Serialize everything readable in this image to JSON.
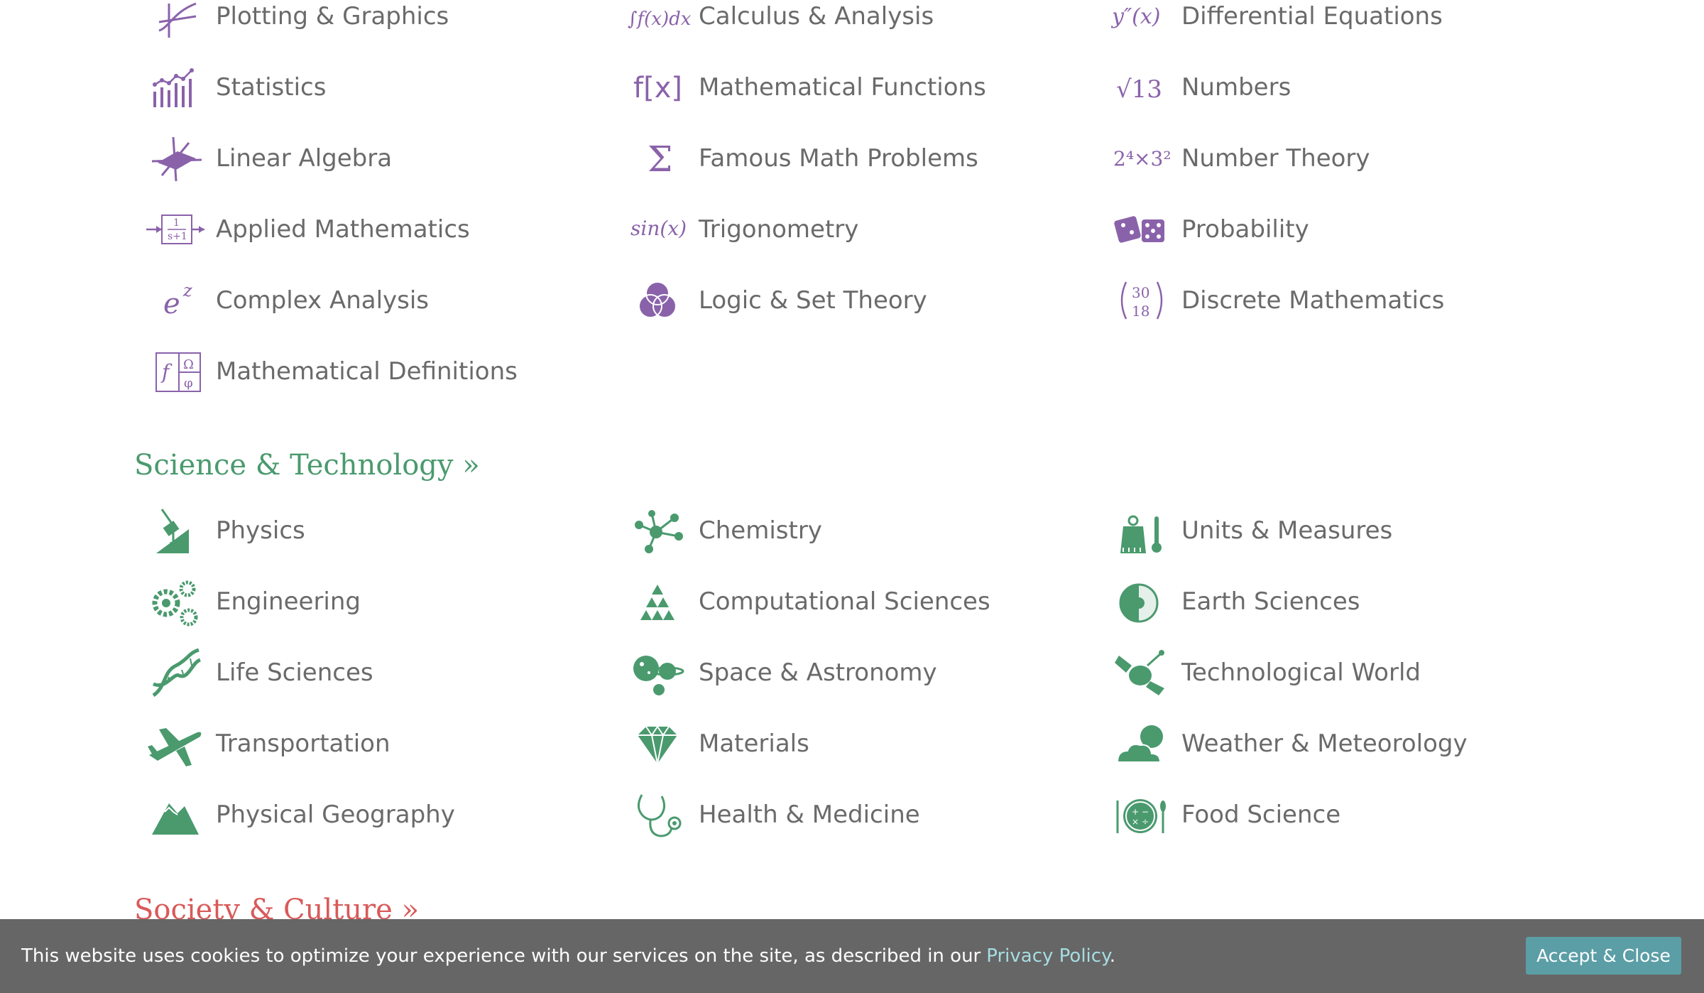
{
  "colors": {
    "math_icon": "#8a62aa",
    "science_icon": "#4a9a6e",
    "science_heading": "#4a9a6e",
    "society_heading": "#d95a5a",
    "cookie_bar_bg": "#666666",
    "cookie_link": "#a6dde2",
    "accept_button_bg": "#5b9ea6"
  },
  "math": {
    "items": [
      {
        "label": "Plotting & Graphics",
        "icon": "plot-icon"
      },
      {
        "label": "Calculus & Analysis",
        "icon": "integral-icon",
        "icon_text": "∫f(x)dx"
      },
      {
        "label": "Differential Equations",
        "icon": "derivative-icon",
        "icon_text": "y″(x)"
      },
      {
        "label": "Statistics",
        "icon": "bar-chart-icon"
      },
      {
        "label": "Mathematical Functions",
        "icon": "function-icon",
        "icon_text": "f[x]"
      },
      {
        "label": "Numbers",
        "icon": "sqrt-icon",
        "icon_text": "√13"
      },
      {
        "label": "Linear Algebra",
        "icon": "vector-plane-icon"
      },
      {
        "label": "Famous Math Problems",
        "icon": "sigma-icon",
        "icon_text": "Σ"
      },
      {
        "label": "Number Theory",
        "icon": "power-product-icon",
        "icon_text": "2⁴×3²"
      },
      {
        "label": "Applied Mathematics",
        "icon": "transfer-function-icon",
        "icon_text_top": "1",
        "icon_text_bottom": "s+1"
      },
      {
        "label": "Trigonometry",
        "icon": "sine-icon",
        "icon_text": "sin(x)"
      },
      {
        "label": "Probability",
        "icon": "dice-icon"
      },
      {
        "label": "Complex Analysis",
        "icon": "exponential-icon",
        "icon_text": "e",
        "icon_sup": "z"
      },
      {
        "label": "Logic & Set Theory",
        "icon": "venn-diagram-icon"
      },
      {
        "label": "Discrete Mathematics",
        "icon": "binomial-icon",
        "icon_text_top": "30",
        "icon_text_bottom": "18"
      },
      {
        "label": "Mathematical Definitions",
        "icon": "definition-grid-icon",
        "icon_text_a": "f",
        "icon_text_b": "Ω",
        "icon_text_c": "φ"
      }
    ]
  },
  "science": {
    "title": "Science & Technology »",
    "items": [
      {
        "label": "Physics",
        "icon": "physics-icon"
      },
      {
        "label": "Chemistry",
        "icon": "molecule-icon"
      },
      {
        "label": "Units & Measures",
        "icon": "weight-thermometer-icon"
      },
      {
        "label": "Engineering",
        "icon": "gears-icon"
      },
      {
        "label": "Computational Sciences",
        "icon": "triangle-pyramid-icon"
      },
      {
        "label": "Earth Sciences",
        "icon": "earth-icon"
      },
      {
        "label": "Life Sciences",
        "icon": "dna-icon"
      },
      {
        "label": "Space & Astronomy",
        "icon": "planets-icon"
      },
      {
        "label": "Technological World",
        "icon": "satellite-icon"
      },
      {
        "label": "Transportation",
        "icon": "airplane-icon"
      },
      {
        "label": "Materials",
        "icon": "diamond-icon"
      },
      {
        "label": "Weather & Meteorology",
        "icon": "cloud-icon"
      },
      {
        "label": "Physical Geography",
        "icon": "mountain-icon"
      },
      {
        "label": "Health & Medicine",
        "icon": "stethoscope-icon"
      },
      {
        "label": "Food Science",
        "icon": "plate-icon"
      }
    ]
  },
  "society": {
    "title": "Society & Culture »"
  },
  "cookie": {
    "text": "This website uses cookies to optimize your experience with our services on the site, as described in our",
    "link": "Privacy Policy",
    "period": ".",
    "button": "Accept & Close"
  }
}
